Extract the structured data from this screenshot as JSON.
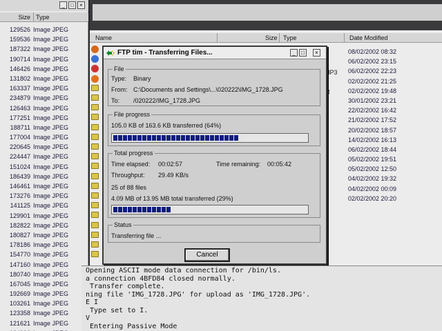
{
  "left_panel": {
    "header": {
      "size": "Size",
      "type": "Type"
    },
    "rows": [
      {
        "size": "129526",
        "type": "Image JPEG"
      },
      {
        "size": "159536",
        "type": "Image JPEG"
      },
      {
        "size": "187322",
        "type": "Image JPEG"
      },
      {
        "size": "190714",
        "type": "Image JPEG"
      },
      {
        "size": "146426",
        "type": "Image JPEG"
      },
      {
        "size": "131802",
        "type": "Image JPEG"
      },
      {
        "size": "163337",
        "type": "Image JPEG"
      },
      {
        "size": "234879",
        "type": "Image JPEG"
      },
      {
        "size": "126463",
        "type": "Image JPEG"
      },
      {
        "size": "177251",
        "type": "Image JPEG"
      },
      {
        "size": "188711",
        "type": "Image JPEG"
      },
      {
        "size": "177004",
        "type": "Image JPEG"
      },
      {
        "size": "220645",
        "type": "Image JPEG"
      },
      {
        "size": "224447",
        "type": "Image JPEG"
      },
      {
        "size": "151024",
        "type": "Image JPEG"
      },
      {
        "size": "186439",
        "type": "Image JPEG"
      },
      {
        "size": "146461",
        "type": "Image JPEG"
      },
      {
        "size": "173276",
        "type": "Image JPEG"
      },
      {
        "size": "141125",
        "type": "Image JPEG"
      },
      {
        "size": "129901",
        "type": "Image JPEG"
      },
      {
        "size": "182822",
        "type": "Image JPEG"
      },
      {
        "size": "180827",
        "type": "Image JPEG"
      },
      {
        "size": "178186",
        "type": "Image JPEG"
      },
      {
        "size": "154770",
        "type": "Image JPEG"
      },
      {
        "size": "147160",
        "type": "Image JPEG"
      },
      {
        "size": "180740",
        "type": "Image JPEG"
      },
      {
        "size": "167045",
        "type": "Image JPEG"
      },
      {
        "size": "192669",
        "type": "Image JPEG"
      },
      {
        "size": "103261",
        "type": "Image JPEG"
      },
      {
        "size": "123358",
        "type": "Image JPEG"
      },
      {
        "size": "121621",
        "type": "Image JPEG"
      },
      {
        "size": "134990",
        "type": "Image JPEG"
      }
    ]
  },
  "right_panel": {
    "header": {
      "name": "Name",
      "size": "Size",
      "type": "Type",
      "date": "Date Modified"
    },
    "type_fragments": [
      "MP3",
      "nt"
    ],
    "dates": [
      "08/02/2002 08:32",
      "06/02/2002 23:15",
      "06/02/2002 22:23",
      "02/02/2002 21:25",
      "02/02/2002 19:48",
      "30/01/2002 23:21",
      "22/02/2002 16:42",
      "21/02/2002 17:52",
      "20/02/2002 18:57",
      "14/02/2002 16:13",
      "06/02/2002 18:44",
      "05/02/2002 19:51",
      "05/02/2002 12:50",
      "04/02/2002 19:32",
      "04/02/2002 00:09",
      "02/02/2002 20:20"
    ]
  },
  "dialog": {
    "title": "FTP tim - Transferring Files...",
    "file_group": {
      "label": "File",
      "type_label": "Type:",
      "type_value": "Binary",
      "from_label": "From:",
      "from_value": "C:\\Documents and Settings\\...\\020222\\IMG_1728.JPG",
      "to_label": "To:",
      "to_value": "/020222/IMG_1728.JPG"
    },
    "file_progress": {
      "label": "File progress",
      "text": "105.0 KB of 163.6 KB transferred (64%)",
      "percent": 64
    },
    "total_progress": {
      "label": "Total progress",
      "elapsed_label": "Time elapsed:",
      "elapsed_value": "00:02:57",
      "remaining_label": "Time remaining:",
      "remaining_value": "00:05:42",
      "throughput_label": "Throughput:",
      "throughput_value": "29.49 KB/s",
      "files_text": "25 of 88 files",
      "bytes_text": "4.09 MB of 13.95 MB total transferred (29%)",
      "percent": 29
    },
    "status": {
      "label": "Status",
      "text": "Transferring file ..."
    },
    "cancel_label": "Cancel"
  },
  "console": {
    "lines": [
      "Opening ASCII mode data connection for /bin/ls.",
      "a connection 4BFD84 closed normally.",
      " Transfer complete.",
      "ning file 'IMG_1728.JPG' for upload as 'IMG_1728.JPG'.",
      "E I",
      " Type set to I.",
      "V",
      " Entering Passive Mode"
    ]
  },
  "colors": {
    "progress_fill": "#0f1d80",
    "desktop_dark": "#2a2a2e"
  }
}
